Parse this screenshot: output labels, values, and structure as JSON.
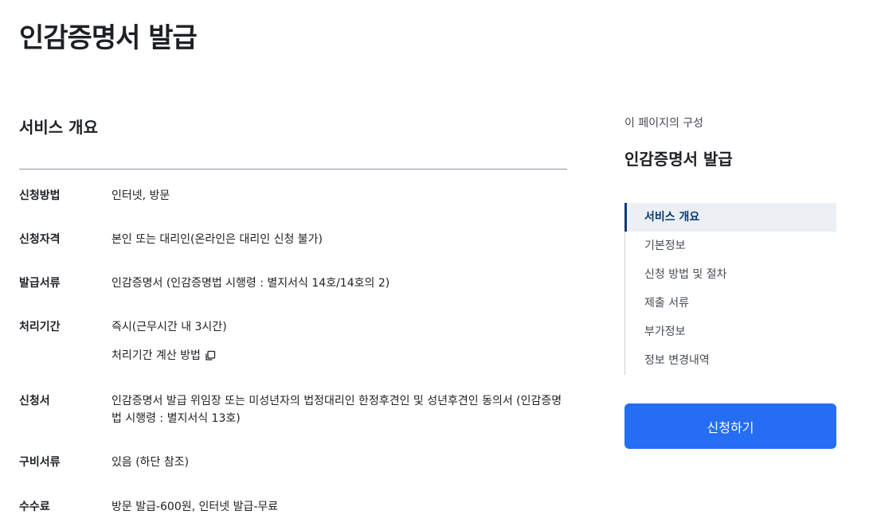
{
  "page": {
    "title": "인감증명서 발급"
  },
  "overview": {
    "title": "서비스 개요",
    "rows": [
      {
        "label": "신청방법",
        "value": "인터넷, 방문"
      },
      {
        "label": "신청자격",
        "value": "본인 또는 대리인(온라인은 대리인 신청 불가)"
      },
      {
        "label": "발급서류",
        "value": "인감증명서 (인감증명법 시행령 : 별지서식 14호/14호의 2)"
      },
      {
        "label": "처리기간",
        "value": "즉시(근무시간 내 3시간)",
        "link": "처리기간 계산 방법"
      },
      {
        "label": "신청서",
        "value": "인감증명서 발급 위임장 또는 미성년자의 법정대리인 한정후견인 및 성년후견인 동의서 (인감증명법 시행령 : 별지서식 13호)"
      },
      {
        "label": "구비서류",
        "value": "있음 (하단 참조)"
      },
      {
        "label": "수수료",
        "value": "방문 발급-600원, 인터넷 발급-무료"
      }
    ]
  },
  "sidebar": {
    "caption": "이 페이지의 구성",
    "title": "인감증명서 발급",
    "toc": [
      "서비스 개요",
      "기본정보",
      "신청 방법 및 절차",
      "제출 서류",
      "부가정보",
      "정보 변경내역"
    ],
    "active_index": 0,
    "apply_label": "신청하기"
  },
  "colors": {
    "primary_button": "#256ef4",
    "toc_active_text": "#063a74",
    "toc_active_bg": "#ecf0f5"
  },
  "icons": {
    "copy": "copy-icon"
  }
}
